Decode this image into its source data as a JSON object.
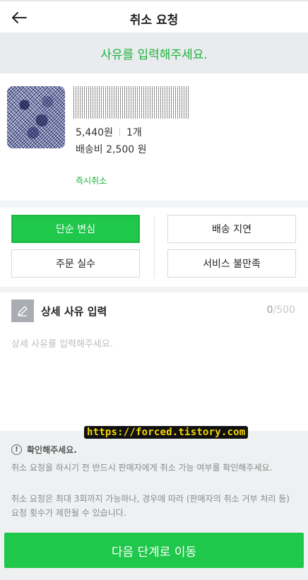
{
  "header": {
    "title": "취소 요청",
    "back_icon": "arrow-left-icon"
  },
  "prompt": {
    "text": "사유를 입력해주세요."
  },
  "product": {
    "price": "5,440원",
    "quantity": "1개",
    "shipping": "배송비 2,500 원",
    "instant_cancel": "즉시취소"
  },
  "reasons": {
    "items": [
      {
        "label": "단순 변심",
        "selected": true
      },
      {
        "label": "배송 지연",
        "selected": false
      },
      {
        "label": "주문 실수",
        "selected": false
      },
      {
        "label": "서비스 불만족",
        "selected": false
      }
    ]
  },
  "detail": {
    "title": "상세 사유 입력",
    "count": "0",
    "max": "/500",
    "placeholder": "상세 사유를 입력해주세요.",
    "icon": "pencil-icon"
  },
  "watermark": {
    "text": "https://forced.tistory.com"
  },
  "notice": {
    "title": "확인해주세요.",
    "icon": "info-circle-icon",
    "p1": "취소 요청을 하시기 전 반드시 판매자에게 취소 가능 여부를 확인해주세요.",
    "p2": "취소 요청은 최대 3회까지 가능하나, 경우에 따라 (판매자의 취소 거부 처리 등) 요청 횟수가 제한될 수 있습니다."
  },
  "footer": {
    "next_label": "다음 단계로 이동"
  },
  "colors": {
    "accent": "#1fc74a",
    "prompt_text": "#1bb33b",
    "band": "#e9ebee"
  }
}
